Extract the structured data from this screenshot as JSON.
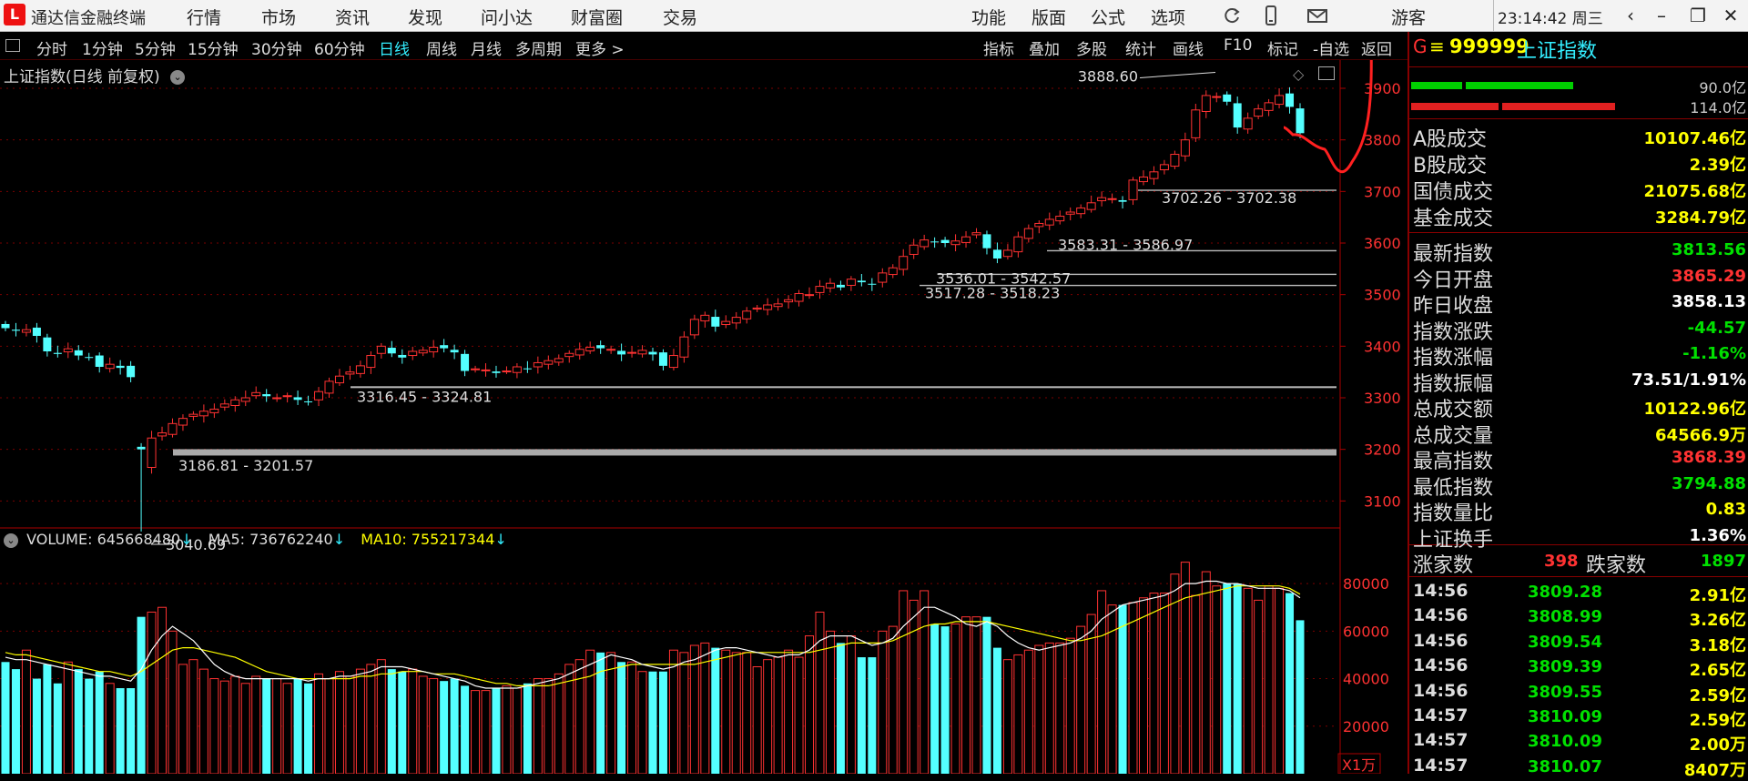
{
  "app": {
    "logo_char": "L",
    "title": "通达信金融终端",
    "menu_left": [
      "行情",
      "市场",
      "资讯",
      "发现",
      "问小达",
      "财富圈",
      "交易"
    ],
    "menu_right": [
      "功能",
      "版面",
      "公式",
      "选项"
    ],
    "user": "游客",
    "clock": "23:14:42 周三",
    "icons": [
      "refresh-icon",
      "phone-icon",
      "mail-icon"
    ]
  },
  "periods": [
    "分时",
    "1分钟",
    "5分钟",
    "15分钟",
    "30分钟",
    "60分钟",
    "日线",
    "周线",
    "月线",
    "多周期",
    "更多 >"
  ],
  "active_period": "日线",
  "toolbar": [
    "指标",
    "叠加",
    "多股",
    "统计",
    "画线",
    "F10",
    "标记",
    "-自选",
    "返回"
  ],
  "chart_header": "上证指数(日线 前复权)",
  "volume_header": {
    "volume_label": "VOLUME: 645668480",
    "ma5_label": "MA5: 736762240",
    "ma10_label": "MA10: 755217344"
  },
  "colors": {
    "up": "#ff3232",
    "down": "#54ffff",
    "grid": "#7a0000",
    "ma5": "#ffffff",
    "ma10": "#ffff00",
    "accent": "#00e0ff"
  },
  "chart_data": [
    {
      "type": "candlestick",
      "title": "上证指数(日线 前复权)",
      "y_ticks": [
        3100,
        3200,
        3300,
        3400,
        3500,
        3600,
        3700,
        3800,
        3900
      ],
      "ylim": [
        3030,
        3930
      ],
      "closes": [
        3435,
        3430,
        3432,
        3420,
        3390,
        3385,
        3395,
        3382,
        3378,
        3360,
        3365,
        3358,
        3340,
        3200,
        3222,
        3232,
        3250,
        3260,
        3268,
        3274,
        3278,
        3288,
        3296,
        3300,
        3310,
        3303,
        3300,
        3304,
        3296,
        3292,
        3312,
        3332,
        3342,
        3350,
        3362,
        3382,
        3400,
        3386,
        3378,
        3390,
        3392,
        3398,
        3396,
        3388,
        3352,
        3356,
        3354,
        3348,
        3352,
        3360,
        3356,
        3368,
        3372,
        3376,
        3386,
        3394,
        3398,
        3396,
        3394,
        3384,
        3388,
        3392,
        3384,
        3362,
        3382,
        3418,
        3452,
        3460,
        3438,
        3448,
        3456,
        3468,
        3474,
        3480,
        3482,
        3490,
        3502,
        3500,
        3516,
        3522,
        3514,
        3530,
        3524,
        3520,
        3542,
        3552,
        3574,
        3596,
        3606,
        3602,
        3600,
        3604,
        3612,
        3620,
        3590,
        3570,
        3586,
        3612,
        3628,
        3638,
        3646,
        3652,
        3660,
        3668,
        3678,
        3688,
        3686,
        3680,
        3722,
        3728,
        3738,
        3752,
        3772,
        3800,
        3858,
        3886,
        3884,
        3874,
        3824,
        3842,
        3860,
        3872,
        3886,
        3864,
        3813
      ],
      "range_labels": [
        {
          "text": "3888.60",
          "price": 3888.6
        },
        {
          "text": "3702.26 - 3702.38",
          "price": 3702.3
        },
        {
          "text": "3583.31 - 3586.97",
          "price": 3585.1
        },
        {
          "text": "3536.01 - 3542.57",
          "price": 3539.3
        },
        {
          "text": "3517.28 - 3518.23",
          "price": 3517.8
        },
        {
          "text": "3316.45 - 3324.81",
          "price": 3320.6
        },
        {
          "text": "3186.81 - 3201.57",
          "price": 3194.2
        },
        {
          "text": "3040.69",
          "price": 3040.69
        }
      ]
    },
    {
      "type": "bar",
      "title": "VOLUME",
      "y_ticks": [
        20000,
        40000,
        60000,
        80000
      ],
      "ylim": [
        0,
        90000
      ],
      "unit_label": "X1万",
      "volumes": [
        47000,
        44000,
        52000,
        40000,
        46000,
        38000,
        47000,
        44000,
        40000,
        43000,
        38000,
        36000,
        36000,
        66000,
        68000,
        70000,
        60000,
        46000,
        48000,
        44000,
        40000,
        39000,
        41000,
        38000,
        41000,
        40000,
        40000,
        38000,
        40000,
        38000,
        42000,
        40000,
        43000,
        41000,
        44000,
        46000,
        48000,
        44000,
        43000,
        44000,
        41000,
        40000,
        39000,
        40000,
        37000,
        35000,
        35000,
        36000,
        37000,
        36000,
        38000,
        40000,
        40000,
        42000,
        46000,
        48000,
        52000,
        51000,
        51000,
        47000,
        47000,
        43000,
        43000,
        43000,
        52000,
        51000,
        54000,
        55000,
        53000,
        52000,
        51000,
        51000,
        45000,
        48000,
        49000,
        52000,
        49000,
        58000,
        68000,
        60000,
        55000,
        58000,
        49000,
        49000,
        60000,
        62000,
        77000,
        73000,
        77000,
        63000,
        62000,
        63000,
        66000,
        66000,
        66000,
        53000,
        48000,
        50000,
        52000,
        54000,
        55000,
        55000,
        57000,
        62000,
        67000,
        77000,
        71000,
        71000,
        72000,
        74000,
        76000,
        76000,
        84000,
        89000,
        75000,
        85000,
        79000,
        80000,
        80000,
        78000,
        73000,
        79000,
        78000,
        76000,
        64570
      ],
      "ma5": [
        49000,
        48000,
        48000,
        47000,
        46000,
        45000,
        44000,
        43000,
        42000,
        41000,
        41000,
        40000,
        39000,
        44000,
        52000,
        58000,
        62000,
        59000,
        56000,
        51000,
        46000,
        43000,
        41000,
        40000,
        40000,
        40000,
        40000,
        40000,
        40000,
        39000,
        40000,
        40000,
        41000,
        41000,
        42000,
        43000,
        45000,
        45000,
        45000,
        44000,
        43000,
        42000,
        41000,
        40000,
        39000,
        37000,
        36000,
        36000,
        36000,
        36000,
        37000,
        38000,
        39000,
        40000,
        42000,
        44000,
        46000,
        48000,
        50000,
        49000,
        48000,
        46000,
        45000,
        44000,
        45000,
        47000,
        48000,
        50000,
        52000,
        53000,
        53000,
        52000,
        51000,
        50000,
        49000,
        50000,
        50000,
        52000,
        56000,
        58000,
        58000,
        58000,
        56000,
        54000,
        55000,
        57000,
        62000,
        66000,
        70000,
        70000,
        68000,
        66000,
        63000,
        62000,
        64000,
        62000,
        58000,
        55000,
        53000,
        52000,
        53000,
        54000,
        55000,
        57000,
        60000,
        65000,
        68000,
        71000,
        72000,
        73000,
        74000,
        75000,
        77000,
        80000,
        80000,
        81000,
        81000,
        80000,
        80000,
        79000,
        78000,
        78000,
        78000,
        77000,
        74000
      ],
      "ma10": [
        51000,
        50000,
        50000,
        49000,
        48000,
        47000,
        46000,
        45000,
        44000,
        43000,
        43000,
        42000,
        41000,
        43000,
        46000,
        49000,
        52000,
        53000,
        53000,
        52000,
        51000,
        50000,
        49000,
        47000,
        45000,
        43000,
        42000,
        41000,
        40000,
        40000,
        40000,
        40000,
        40000,
        40000,
        41000,
        41000,
        42000,
        42000,
        43000,
        43000,
        43000,
        42000,
        42000,
        42000,
        41000,
        40000,
        39000,
        38000,
        38000,
        37000,
        37000,
        37000,
        37000,
        38000,
        39000,
        40000,
        41000,
        43000,
        44000,
        45000,
        46000,
        46000,
        46000,
        46000,
        46000,
        46000,
        46000,
        47000,
        48000,
        49000,
        50000,
        51000,
        51000,
        51000,
        51000,
        51000,
        51000,
        51000,
        52000,
        53000,
        54000,
        55000,
        55000,
        55000,
        55000,
        56000,
        58000,
        60000,
        62000,
        63000,
        63000,
        64000,
        64000,
        64000,
        64000,
        63000,
        62000,
        61000,
        60000,
        59000,
        58000,
        57000,
        56000,
        56000,
        57000,
        58000,
        60000,
        62000,
        64000,
        66000,
        68000,
        70000,
        72000,
        74000,
        75000,
        76000,
        77000,
        78000,
        79000,
        79000,
        79000,
        79000,
        79000,
        78000,
        75520
      ]
    }
  ],
  "quote": {
    "flag": "G",
    "code": "999999",
    "name": "上证指数",
    "bar1_pct": "90.0亿",
    "bar2_pct": "114.0亿",
    "turnover": [
      {
        "label": "A股成交",
        "value": "10107.46亿"
      },
      {
        "label": "B股成交",
        "value": "2.39亿"
      },
      {
        "label": "国债成交",
        "value": "21075.68亿"
      },
      {
        "label": "基金成交",
        "value": "3284.79亿"
      }
    ],
    "stats": [
      {
        "label": "最新指数",
        "value": "3813.56",
        "color": "#00e000"
      },
      {
        "label": "今日开盘",
        "value": "3865.29",
        "color": "#ff3232"
      },
      {
        "label": "昨日收盘",
        "value": "3858.13",
        "color": "#ffffff"
      },
      {
        "label": "指数涨跌",
        "value": "-44.57",
        "color": "#00e000"
      },
      {
        "label": "指数涨幅",
        "value": "-1.16%",
        "color": "#00e000"
      },
      {
        "label": "指数振幅",
        "value": "73.51/1.91%",
        "color": "#ffffff"
      },
      {
        "label": "总成交额",
        "value": "10122.96亿",
        "color": "#ffff00"
      },
      {
        "label": "总成交量",
        "value": "64566.9万",
        "color": "#ffff00"
      },
      {
        "label": "最高指数",
        "value": "3868.39",
        "color": "#ff3232"
      },
      {
        "label": "最低指数",
        "value": "3794.88",
        "color": "#00e000"
      },
      {
        "label": "指数量比",
        "value": "0.83",
        "color": "#ffff00"
      },
      {
        "label": "上证换手",
        "value": "1.36%",
        "color": "#ffffff"
      }
    ],
    "up_label": "涨家数",
    "up_count": "398",
    "down_label": "跌家数",
    "down_count": "1897",
    "ticks": [
      {
        "time": "14:56",
        "price": "3809.28",
        "amount": "2.91亿"
      },
      {
        "time": "14:56",
        "price": "3808.99",
        "amount": "3.26亿"
      },
      {
        "time": "14:56",
        "price": "3809.54",
        "amount": "3.18亿"
      },
      {
        "time": "14:56",
        "price": "3809.39",
        "amount": "2.65亿"
      },
      {
        "time": "14:56",
        "price": "3809.55",
        "amount": "2.59亿"
      },
      {
        "time": "14:57",
        "price": "3810.09",
        "amount": "2.59亿"
      },
      {
        "time": "14:57",
        "price": "3810.09",
        "amount": "2.00万"
      },
      {
        "time": "14:57",
        "price": "3810.07",
        "amount": "8407万"
      }
    ]
  }
}
